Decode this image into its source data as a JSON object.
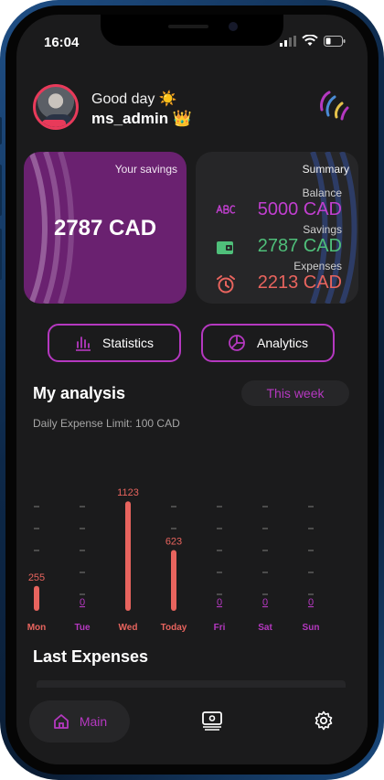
{
  "status_bar": {
    "time": "16:04"
  },
  "header": {
    "greeting": "Good day ☀️",
    "username": "ms_admin 👑"
  },
  "savings_card": {
    "label": "Your savings",
    "amount": "2787 CAD"
  },
  "summary_card": {
    "label": "Summary",
    "rows": [
      {
        "caption": "Balance",
        "value": "5000 CAD",
        "color": "#c13fcf"
      },
      {
        "caption": "Savings",
        "value": "2787 CAD",
        "color": "#4fbf7a"
      },
      {
        "caption": "Expenses",
        "value": "2213 CAD",
        "color": "#e8645e"
      }
    ]
  },
  "buttons": {
    "statistics": "Statistics",
    "analytics": "Analytics"
  },
  "analysis": {
    "title": "My analysis",
    "period": "This week",
    "limit_text": "Daily Expense Limit: 100 CAD"
  },
  "chart_data": {
    "type": "bar",
    "categories": [
      "Mon",
      "Tue",
      "Wed",
      "Today",
      "Fri",
      "Sat",
      "Sun"
    ],
    "values": [
      255,
      0,
      1123,
      623,
      0,
      0,
      0
    ],
    "value_labels": [
      "255",
      "0",
      "1123",
      "623",
      "0",
      "0",
      "0"
    ],
    "bar_color": "#e8645e",
    "zero_color": "#b538c0",
    "active_label_color": "#e8645e",
    "inactive_label_color": "#b538c0",
    "ylim": [
      0,
      1200
    ]
  },
  "last_expenses": {
    "title": "Last Expenses"
  },
  "nav": {
    "main_label": "Main"
  },
  "colors": {
    "accent": "#b538c0",
    "savings_bg": "#6a2170",
    "bg": "#1b1b1c"
  }
}
